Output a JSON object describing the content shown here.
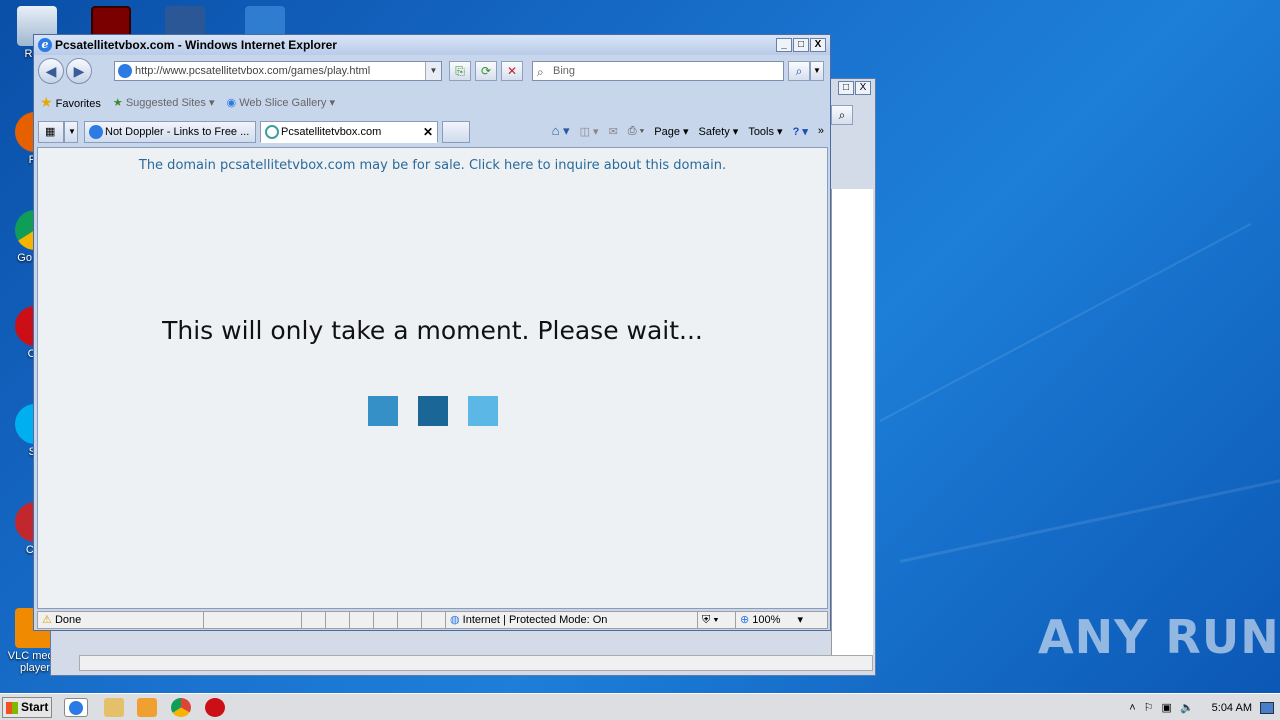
{
  "desktop": {
    "icons": [
      {
        "label": "Recy"
      },
      {
        "label": "Fir"
      },
      {
        "label": "Go Chr"
      },
      {
        "label": "Op"
      },
      {
        "label": "Sk"
      },
      {
        "label": "CCl"
      },
      {
        "label": "VLC media player"
      }
    ],
    "watermark": "ANY RUN"
  },
  "browser": {
    "title": "Pcsatellitetvbox.com - Windows Internet Explorer",
    "window_buttons": {
      "minimize": "_",
      "maximize": "□",
      "close": "X"
    },
    "address": "http://www.pcsatellitetvbox.com/games/play.html",
    "search_placeholder": "Bing",
    "favorites": {
      "favorites_label": "Favorites",
      "suggested_sites": "Suggested Sites",
      "web_slice_gallery": "Web Slice Gallery"
    },
    "tabs": [
      {
        "label": "Not Doppler - Links to Free ..."
      },
      {
        "label": "Pcsatellitetvbox.com"
      }
    ],
    "commands": {
      "page": "Page",
      "safety": "Safety",
      "tools": "Tools"
    },
    "page": {
      "notice": "The domain pcsatellitetvbox.com may be for sale. Click here to inquire about this domain.",
      "wait_message": "This will only take a moment. Please wait...",
      "loader_colors": [
        "#3590c8",
        "#1a6797",
        "#5ab7e6"
      ]
    },
    "status": {
      "text": "Done",
      "zone": "Internet | Protected Mode: On",
      "zoom": "100%"
    }
  },
  "taskbar": {
    "start_label": "Start",
    "clock": "5:04 AM"
  }
}
